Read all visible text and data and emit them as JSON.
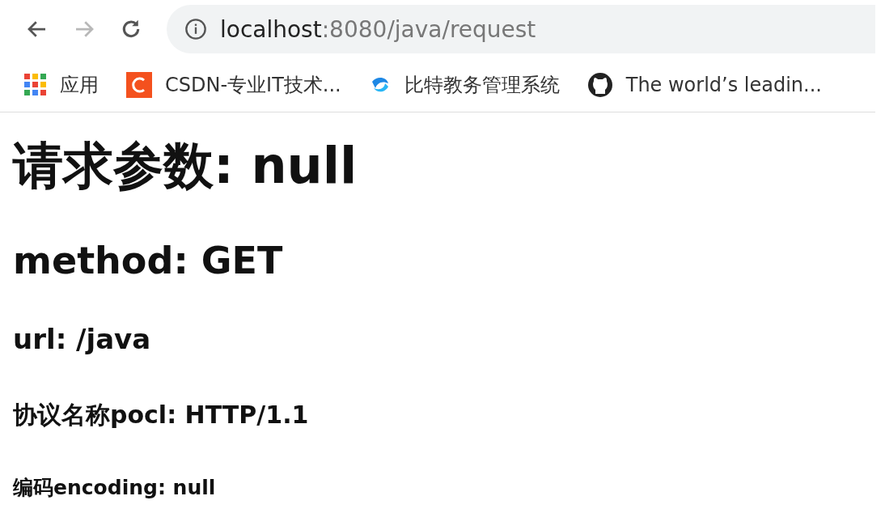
{
  "toolbar": {
    "back": {
      "disabled": false
    },
    "forward": {
      "disabled": true
    },
    "address": {
      "host": "localhost",
      "path": ":8080/java/request"
    }
  },
  "bookmarks": [
    {
      "kind": "apps",
      "label": "应用"
    },
    {
      "kind": "csdn",
      "label": "CSDN-专业IT技术..."
    },
    {
      "kind": "leaf",
      "label": "比特教务管理系统"
    },
    {
      "kind": "github",
      "label": "The world’s leadin..."
    }
  ],
  "headings": [
    {
      "kind": "h1",
      "text": "请求参数: null"
    },
    {
      "kind": "h2",
      "text": "method: GET"
    },
    {
      "kind": "h3",
      "text": "url: /java"
    },
    {
      "kind": "h4",
      "text": "协议名称pocl: HTTP/1.1"
    },
    {
      "kind": "h5",
      "text": "编码encoding: null"
    }
  ]
}
